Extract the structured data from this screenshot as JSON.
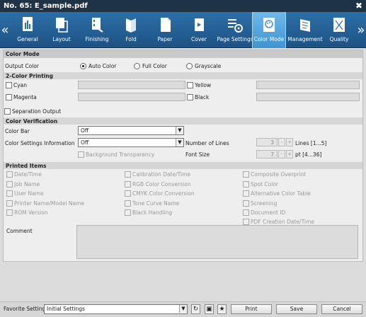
{
  "window": {
    "title": "No. 65: E_sample.pdf",
    "close_glyph": "✖"
  },
  "nav": {
    "prev_glyph": "«",
    "next_glyph": "»"
  },
  "tabs": [
    {
      "label": "General",
      "icon": "general-icon"
    },
    {
      "label": "Layout",
      "icon": "layout-icon"
    },
    {
      "label": "Finishing",
      "icon": "finishing-icon"
    },
    {
      "label": "Fold",
      "icon": "fold-icon"
    },
    {
      "label": "Paper",
      "icon": "paper-icon"
    },
    {
      "label": "Cover",
      "icon": "cover-icon"
    },
    {
      "label": "Page Settings",
      "icon": "page-settings-icon"
    },
    {
      "label": "Color Mode",
      "icon": "color-mode-icon",
      "active": true
    },
    {
      "label": "Management",
      "icon": "management-icon"
    },
    {
      "label": "Quality",
      "icon": "quality-icon"
    }
  ],
  "color_mode": {
    "heading": "Color Mode",
    "output_color_label": "Output Color",
    "options": [
      "Auto Color",
      "Full Color",
      "Grayscale"
    ],
    "selected": "Auto Color"
  },
  "two_color": {
    "heading": "2-Color Printing",
    "cyan": "Cyan",
    "yellow": "Yellow",
    "magenta": "Magenta",
    "black": "Black"
  },
  "separation_output": "Separation Output",
  "color_verification": {
    "heading": "Color Verification",
    "color_bar_label": "Color Bar",
    "color_bar_value": "Off",
    "color_settings_label": "Color Settings Information",
    "color_settings_value": "Off",
    "background_transparency": "Background Transparency",
    "number_of_lines_label": "Number of Lines",
    "number_of_lines_value": "3",
    "number_of_lines_range": "Lines [1...5]",
    "font_size_label": "Font Size",
    "font_size_value": "7",
    "font_size_range": "pt [4...36]",
    "minus": "-",
    "plus": "+"
  },
  "printed_items": {
    "heading": "Printed Items",
    "col1": [
      "Date/Time",
      "Job Name",
      "User Name",
      "Printer Name/Model Name",
      "ROM Version"
    ],
    "col2": [
      "Calibration Date/Time",
      "RGB Color Conversion",
      "CMYK Color Conversion",
      "Tone Curve Name",
      "Black Handling"
    ],
    "col3": [
      "Composite Overprint",
      "Spot Color",
      "Alternative Color Table",
      "Screening",
      "Document ID",
      "PDF Creation Date/Time"
    ],
    "comment_label": "Comment"
  },
  "footer": {
    "favorite_label": "Favorite Setting",
    "favorite_value": "Initial Settings",
    "print": "Print",
    "save": "Save",
    "cancel": "Cancel"
  },
  "colors": {
    "titlebar": "#1f3346",
    "tabbar": "#2c6fa8",
    "active_tab": "#4a9fd8"
  }
}
